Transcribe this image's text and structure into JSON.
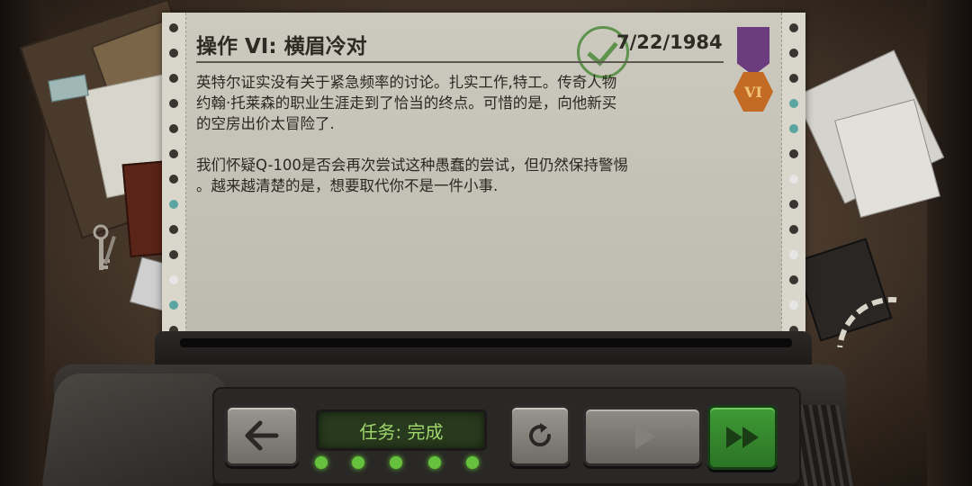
{
  "briefing": {
    "title": "操作 VI: 横眉冷对",
    "date": "7/22/1984",
    "paragraphs": [
      "英特尔证实没有关于紧急频率的讨论。扎实工作,特工。传奇人物\n约翰·托莱森的职业生涯走到了恰当的终点。可惜的是，向他新买\n的空房出价太冒险了.",
      "我们怀疑Q-100是否会再次尝试这种愚蠢的尝试，但仍然保持警惕\n。越来越清楚的是，想要取代你不是一件小事."
    ],
    "medal_label": "VI",
    "stamp_icon": "checkmark-stamp-icon"
  },
  "controls": {
    "status_text": "任务: 完成",
    "back_icon": "arrow-left-icon",
    "restart_icon": "restart-icon",
    "play_icon": "play-icon",
    "fast_forward_icon": "fast-forward-icon",
    "status_lights": 5
  },
  "colors": {
    "paper": "#c8c5b9",
    "text": "#2c2822",
    "status_green": "#9ed56b",
    "ff_button": "#3f9b35",
    "medal_ribbon": "#6b3c7e",
    "medal_badge": "#c36b24"
  }
}
